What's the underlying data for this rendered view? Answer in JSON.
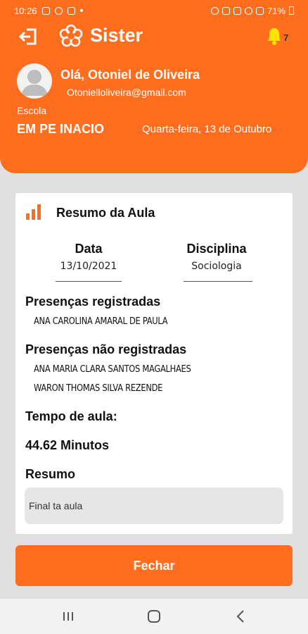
{
  "status_bar": {
    "time": "10:26",
    "battery": "71%"
  },
  "header": {
    "app_name": "Sister",
    "notification_count": "7",
    "greeting": "Olá, Otoniel de Oliveira",
    "email": "Otonielloliveira@gmail.com",
    "school_label": "Escola",
    "school_name": "EM PE INACIO",
    "date": "Quarta-feira, 13 de Outubro"
  },
  "card": {
    "title": "Resumo da Aula",
    "data_label": "Data",
    "data_value": "13/10/2021",
    "disciplina_label": "Disciplina",
    "disciplina_value": "Sociologia",
    "presencas_registradas_title": "Presenças registradas",
    "presencas_registradas": [
      "ANA CAROLINA AMARAL DE PAULA"
    ],
    "presencas_nao_registradas_title": "Presenças não registradas",
    "presencas_nao_registradas": [
      "ANA MARIA CLARA SANTOS MAGALHAES",
      "WARON THOMAS SILVA REZENDE"
    ],
    "tempo_title": "Tempo de aula:",
    "tempo_value": "44.62 Minutos",
    "resumo_title": "Resumo",
    "resumo_text": "Final ta aula"
  },
  "fechar_label": "Fechar",
  "colors": {
    "accent": "#ff6d1f"
  },
  "icons": [
    "logout-icon",
    "flower-logo-icon",
    "bell-icon",
    "avatar-icon",
    "bar-chart-icon",
    "recents-icon",
    "home-icon",
    "back-icon"
  ]
}
